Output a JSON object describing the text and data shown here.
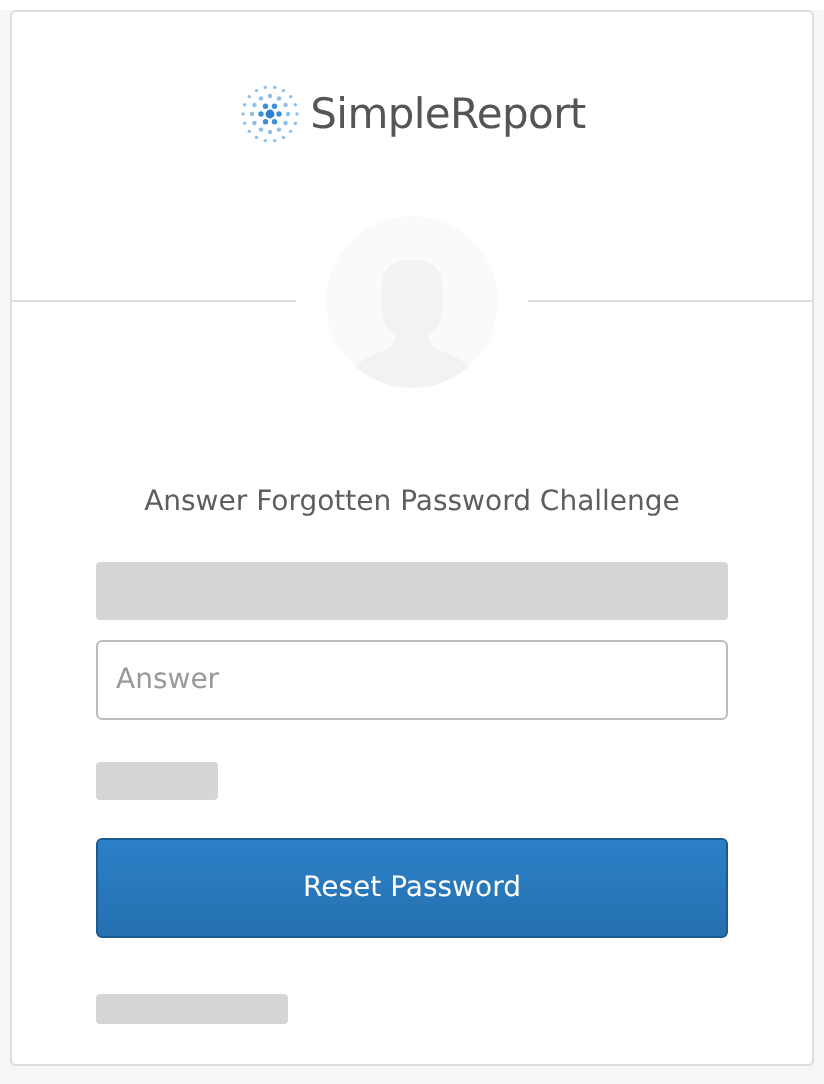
{
  "logo": {
    "text": "SimpleReport"
  },
  "title": "Answer Forgotten Password Challenge",
  "answer_field": {
    "placeholder": "Answer"
  },
  "button": {
    "label": "Reset Password"
  }
}
